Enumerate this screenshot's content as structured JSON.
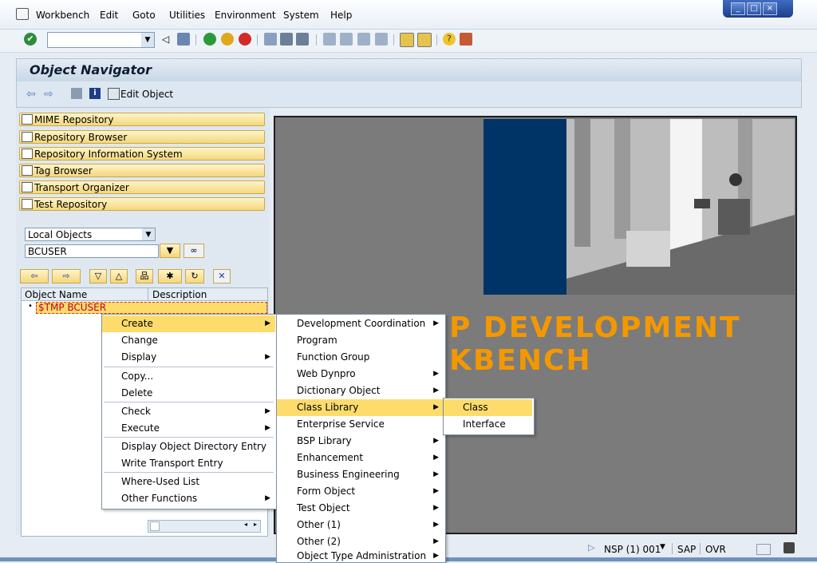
{
  "menubar": {
    "items": [
      "Workbench",
      "Edit",
      "Goto",
      "Utilities",
      "Environment",
      "System",
      "Help"
    ]
  },
  "toolbar": {
    "command_value": ""
  },
  "title": "Object Navigator",
  "app_toolbar": {
    "edit_object": "Edit Object"
  },
  "nav_buttons": [
    "MIME Repository",
    "Repository Browser",
    "Repository Information System",
    "Tag Browser",
    "Transport Organizer",
    "Test Repository"
  ],
  "object_list": {
    "type_value": "Local Objects",
    "user_value": "BCUSER"
  },
  "tree": {
    "col_object_name": "Object Name",
    "col_description": "Description",
    "root_node": "$TMP BCUSER"
  },
  "banner": {
    "line1": "P DEVELOPMENT",
    "line2": "KBENCH"
  },
  "context_menu": [
    "Create",
    "Change",
    "Display",
    "Copy...",
    "Delete",
    "Check",
    "Execute",
    "Display Object Directory Entry",
    "Write Transport Entry",
    "Where-Used List",
    "Other Functions"
  ],
  "create_submenu": [
    "Development Coordination",
    "Program",
    "Function Group",
    "Web Dynpro",
    "Dictionary Object",
    "Class Library",
    "Enterprise Service",
    "BSP Library",
    "Enhancement",
    "Business Engineering",
    "Form Object",
    "Test Object",
    "Other (1)",
    "Other (2)",
    "Object Type Administration"
  ],
  "class_submenu": [
    "Class",
    "Interface"
  ],
  "status": {
    "system": "NSP (1) 001",
    "server": "SAP",
    "mode": "OVR"
  },
  "colors": {
    "highlight": "#fddc6c",
    "banner_text": "#f39800",
    "banner_blue": "#003366"
  }
}
